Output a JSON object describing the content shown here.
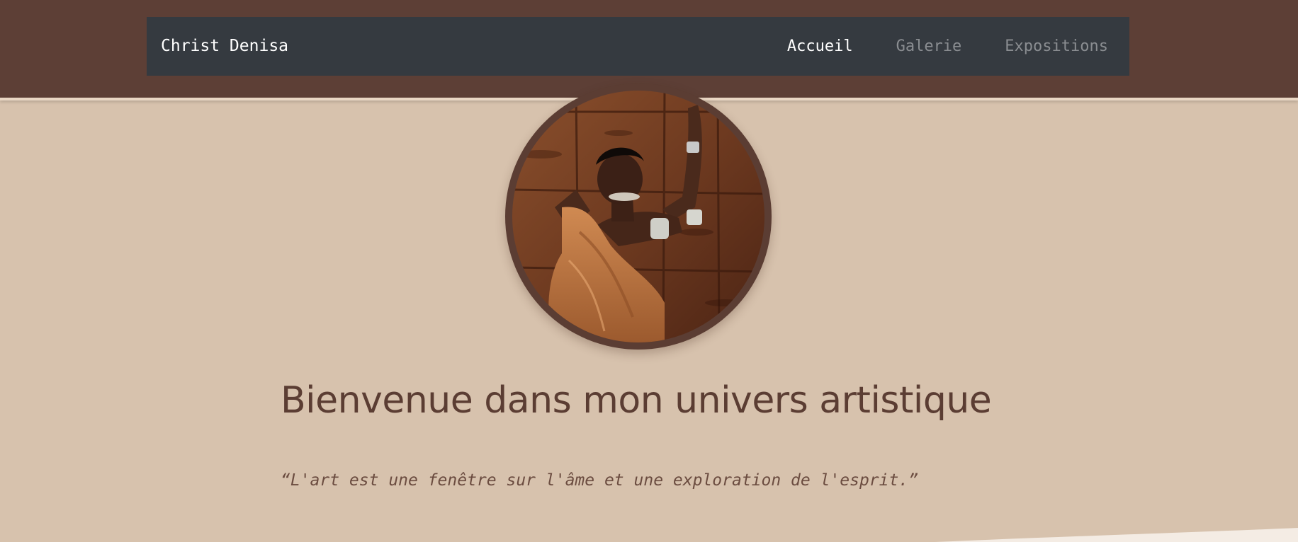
{
  "navbar": {
    "brand": "Christ Denisa",
    "links": [
      {
        "label": "Accueil",
        "active": true
      },
      {
        "label": "Galerie",
        "active": false
      },
      {
        "label": "Expositions",
        "active": false
      }
    ]
  },
  "hero": {
    "image_subject": "portrait of a woman in ochre drape against a wooden wall",
    "title": "Bienvenue dans mon univers artistique",
    "quote": "“L'art est une fenêtre sur l'âme et une exploration de l'esprit.”"
  },
  "colors": {
    "header_bg": "#5d3f36",
    "navbar_bg": "#353a40",
    "page_bg": "#d7c2ad",
    "accent_brown": "#5b3d33",
    "nav_link_inactive": "#8a8d91",
    "nav_link_active": "#ffffff"
  }
}
